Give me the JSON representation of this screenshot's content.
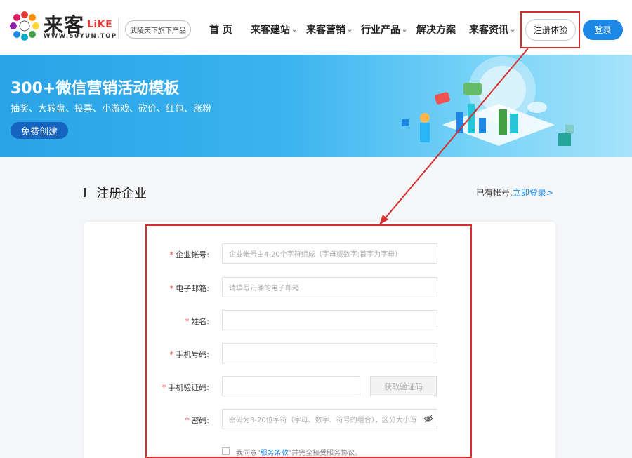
{
  "brand": {
    "name": "来客",
    "suffix": "LiKE",
    "url": "WWW.50YUN.TOP"
  },
  "header": {
    "tag": "武陵天下旗下产品",
    "nav": [
      {
        "label": "首 页",
        "caret": false
      },
      {
        "label": "来客建站",
        "caret": true
      },
      {
        "label": "来客营销",
        "caret": true
      },
      {
        "label": "行业产品",
        "caret": true
      },
      {
        "label": "解决方案",
        "caret": false
      },
      {
        "label": "来客资讯",
        "caret": true
      }
    ],
    "register_label": "注册体验",
    "login_label": "登录"
  },
  "banner": {
    "title": "300+微信营销活动模板",
    "subtitle": "抽奖、大转盘、投票、小游戏、砍价、红包、涨粉",
    "button": "免费创建"
  },
  "section": {
    "title": "注册企业",
    "have_account": "已有帐号,",
    "login_link": "立即登录>"
  },
  "form": {
    "fields": [
      {
        "label": "企业帐号:",
        "required": true,
        "placeholder": "企业帐号由4-20个字符组成（字母或数字;首字为字母）"
      },
      {
        "label": "电子邮箱:",
        "required": true,
        "placeholder": "请填写正确的电子邮箱"
      },
      {
        "label": "姓名:",
        "required": true,
        "placeholder": ""
      },
      {
        "label": "手机号码:",
        "required": true,
        "placeholder": ""
      },
      {
        "label": "手机验证码:",
        "required": true,
        "placeholder": ""
      },
      {
        "label": "密码:",
        "required": true,
        "placeholder": "密码为8-20位字符（字母、数字、符号的组合），区分大小写"
      }
    ],
    "sms_button": "获取验证码",
    "agree_prefix": "我同意\"",
    "agree_link": "服务条款",
    "agree_suffix": "\"并完全接受服务协议。"
  },
  "colors": {
    "accent": "#1e88e5",
    "highlight": "#d32f2f",
    "required": "#e53935"
  }
}
